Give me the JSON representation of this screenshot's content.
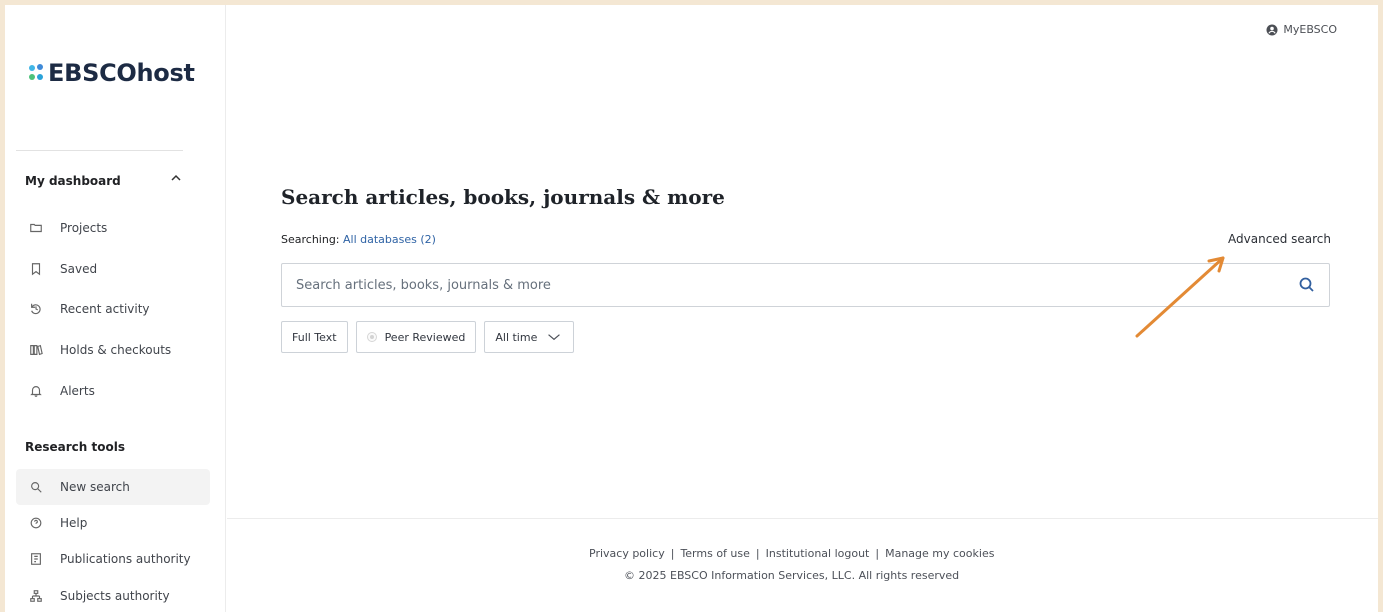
{
  "brand": {
    "name": "EBSCOhost"
  },
  "header": {
    "account_label": "MyEBSCO"
  },
  "sidebar": {
    "dashboard_title": "My dashboard",
    "dashboard_items": [
      {
        "label": "Projects",
        "icon": "folder-icon"
      },
      {
        "label": "Saved",
        "icon": "bookmark-icon"
      },
      {
        "label": "Recent activity",
        "icon": "history-icon"
      },
      {
        "label": "Holds & checkouts",
        "icon": "books-icon"
      },
      {
        "label": "Alerts",
        "icon": "bell-icon"
      }
    ],
    "research_title": "Research tools",
    "research_items": [
      {
        "label": "New search",
        "icon": "search-icon",
        "active": true
      },
      {
        "label": "Help",
        "icon": "help-icon"
      },
      {
        "label": "Publications authority",
        "icon": "publication-icon"
      },
      {
        "label": "Subjects authority",
        "icon": "hierarchy-icon"
      }
    ]
  },
  "main": {
    "title": "Search articles, books, journals & more",
    "searching_prefix": "Searching:",
    "searching_link": "All databases (2)",
    "advanced_search": "Advanced search",
    "search_placeholder": "Search articles, books, journals & more",
    "filters": {
      "full_text": "Full Text",
      "peer_reviewed": "Peer Reviewed",
      "time_range": "All time"
    }
  },
  "footer": {
    "links": [
      "Privacy policy",
      "Terms of use",
      "Institutional logout",
      "Manage my cookies"
    ],
    "copyright": "© 2025 EBSCO Information Services, LLC. All rights reserved"
  },
  "colors": {
    "background_frame": "#f4e7d3",
    "brand_dark": "#1d2b44",
    "link_blue": "#2f63a5",
    "annotation_orange": "#e38a35"
  }
}
